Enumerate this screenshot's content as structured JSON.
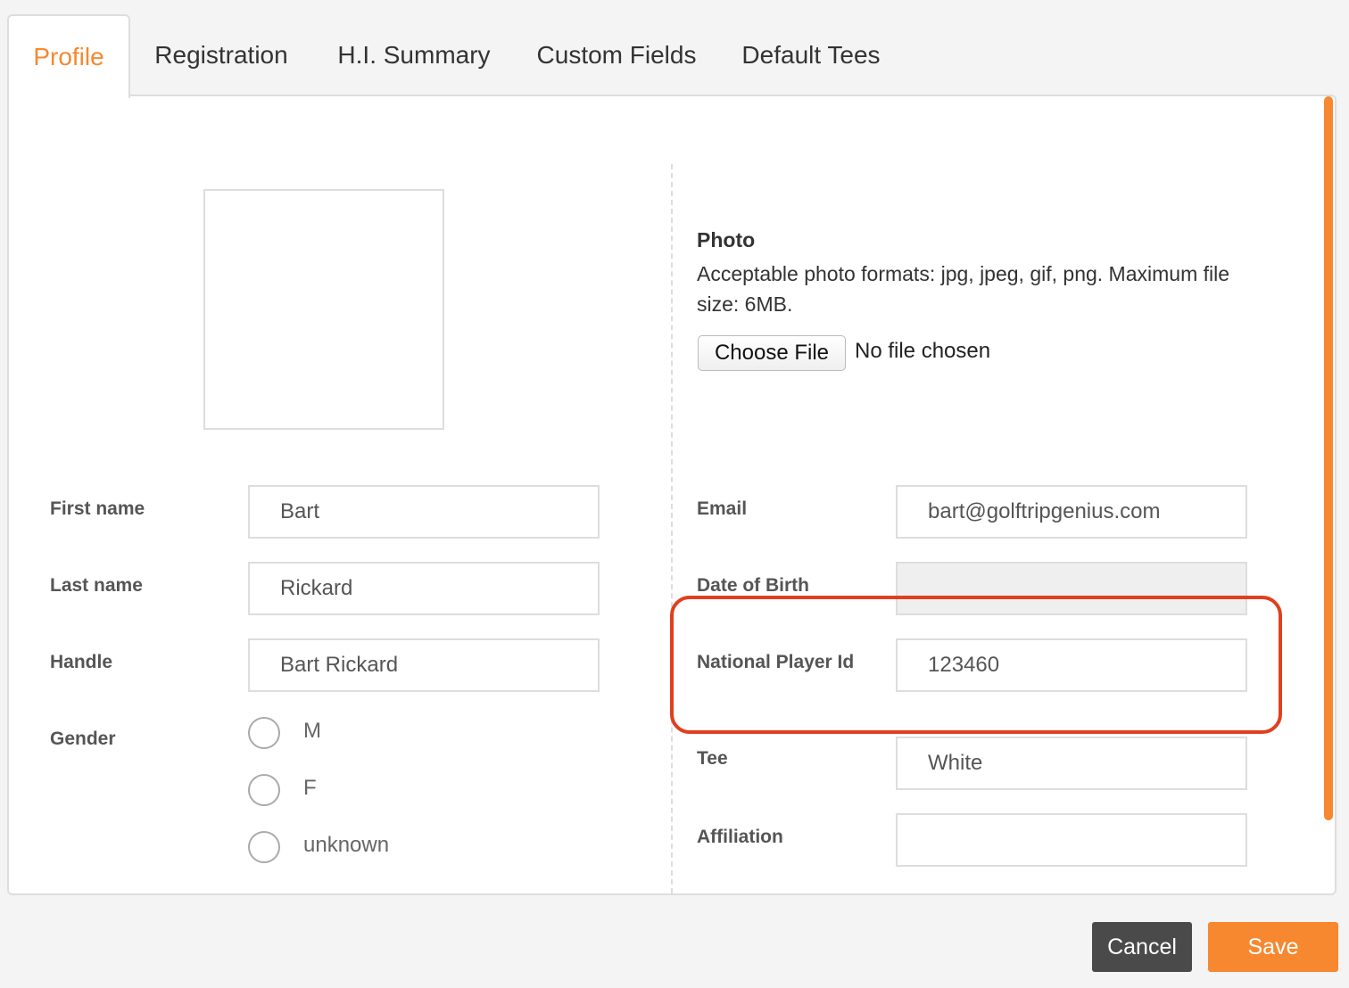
{
  "tabs": [
    {
      "label": "Profile",
      "active": true
    },
    {
      "label": "Registration",
      "active": false
    },
    {
      "label": "H.I. Summary",
      "active": false
    },
    {
      "label": "Custom Fields",
      "active": false
    },
    {
      "label": "Default Tees",
      "active": false
    }
  ],
  "photo": {
    "title": "Photo",
    "description": "Acceptable photo formats: jpg, jpeg, gif, png. Maximum file size: 6MB.",
    "choose_file_label": "Choose File",
    "file_status": "No file chosen"
  },
  "left_fields": {
    "first_name": {
      "label": "First name",
      "value": "Bart"
    },
    "last_name": {
      "label": "Last name",
      "value": "Rickard"
    },
    "handle": {
      "label": "Handle",
      "value": "Bart Rickard"
    },
    "gender": {
      "label": "Gender",
      "options": [
        "M",
        "F",
        "unknown"
      ],
      "selected": null
    }
  },
  "right_fields": {
    "email": {
      "label": "Email",
      "value": "bart@golftripgenius.com"
    },
    "date_of_birth": {
      "label": "Date of Birth",
      "value": ""
    },
    "national_player_id": {
      "label": "National Player Id",
      "value": "123460"
    },
    "tee": {
      "label": "Tee",
      "value": "White"
    },
    "affiliation": {
      "label": "Affiliation",
      "value": ""
    }
  },
  "buttons": {
    "cancel": "Cancel",
    "save": "Save"
  },
  "colors": {
    "accent": "#f7882f",
    "highlight_annotation": "#e0401f",
    "cancel_button": "#4a4a4a"
  },
  "annotation": {
    "target": "national-player-id-field",
    "shape": "rounded-rectangle"
  }
}
